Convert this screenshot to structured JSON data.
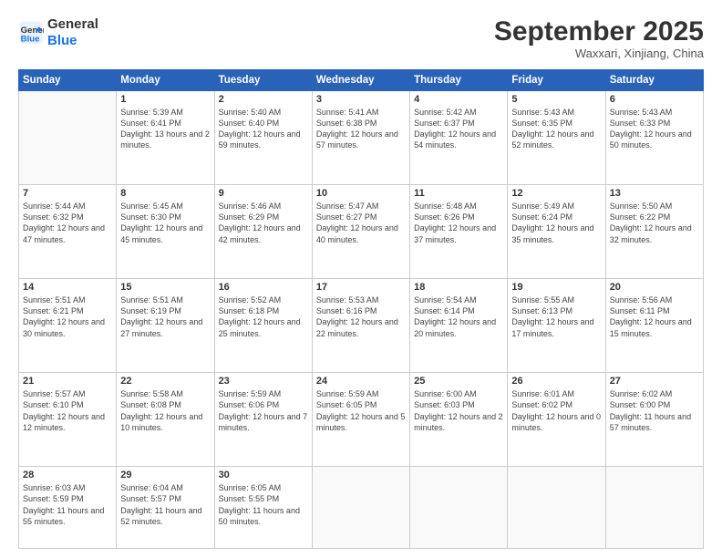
{
  "logo": {
    "line1": "General",
    "line2": "Blue"
  },
  "header": {
    "month": "September 2025",
    "location": "Waxxari, Xinjiang, China"
  },
  "weekdays": [
    "Sunday",
    "Monday",
    "Tuesday",
    "Wednesday",
    "Thursday",
    "Friday",
    "Saturday"
  ],
  "weeks": [
    [
      {
        "day": "",
        "info": ""
      },
      {
        "day": "1",
        "info": "Sunrise: 5:39 AM\nSunset: 6:41 PM\nDaylight: 13 hours\nand 2 minutes."
      },
      {
        "day": "2",
        "info": "Sunrise: 5:40 AM\nSunset: 6:40 PM\nDaylight: 12 hours\nand 59 minutes."
      },
      {
        "day": "3",
        "info": "Sunrise: 5:41 AM\nSunset: 6:38 PM\nDaylight: 12 hours\nand 57 minutes."
      },
      {
        "day": "4",
        "info": "Sunrise: 5:42 AM\nSunset: 6:37 PM\nDaylight: 12 hours\nand 54 minutes."
      },
      {
        "day": "5",
        "info": "Sunrise: 5:43 AM\nSunset: 6:35 PM\nDaylight: 12 hours\nand 52 minutes."
      },
      {
        "day": "6",
        "info": "Sunrise: 5:43 AM\nSunset: 6:33 PM\nDaylight: 12 hours\nand 50 minutes."
      }
    ],
    [
      {
        "day": "7",
        "info": "Sunrise: 5:44 AM\nSunset: 6:32 PM\nDaylight: 12 hours\nand 47 minutes."
      },
      {
        "day": "8",
        "info": "Sunrise: 5:45 AM\nSunset: 6:30 PM\nDaylight: 12 hours\nand 45 minutes."
      },
      {
        "day": "9",
        "info": "Sunrise: 5:46 AM\nSunset: 6:29 PM\nDaylight: 12 hours\nand 42 minutes."
      },
      {
        "day": "10",
        "info": "Sunrise: 5:47 AM\nSunset: 6:27 PM\nDaylight: 12 hours\nand 40 minutes."
      },
      {
        "day": "11",
        "info": "Sunrise: 5:48 AM\nSunset: 6:26 PM\nDaylight: 12 hours\nand 37 minutes."
      },
      {
        "day": "12",
        "info": "Sunrise: 5:49 AM\nSunset: 6:24 PM\nDaylight: 12 hours\nand 35 minutes."
      },
      {
        "day": "13",
        "info": "Sunrise: 5:50 AM\nSunset: 6:22 PM\nDaylight: 12 hours\nand 32 minutes."
      }
    ],
    [
      {
        "day": "14",
        "info": "Sunrise: 5:51 AM\nSunset: 6:21 PM\nDaylight: 12 hours\nand 30 minutes."
      },
      {
        "day": "15",
        "info": "Sunrise: 5:51 AM\nSunset: 6:19 PM\nDaylight: 12 hours\nand 27 minutes."
      },
      {
        "day": "16",
        "info": "Sunrise: 5:52 AM\nSunset: 6:18 PM\nDaylight: 12 hours\nand 25 minutes."
      },
      {
        "day": "17",
        "info": "Sunrise: 5:53 AM\nSunset: 6:16 PM\nDaylight: 12 hours\nand 22 minutes."
      },
      {
        "day": "18",
        "info": "Sunrise: 5:54 AM\nSunset: 6:14 PM\nDaylight: 12 hours\nand 20 minutes."
      },
      {
        "day": "19",
        "info": "Sunrise: 5:55 AM\nSunset: 6:13 PM\nDaylight: 12 hours\nand 17 minutes."
      },
      {
        "day": "20",
        "info": "Sunrise: 5:56 AM\nSunset: 6:11 PM\nDaylight: 12 hours\nand 15 minutes."
      }
    ],
    [
      {
        "day": "21",
        "info": "Sunrise: 5:57 AM\nSunset: 6:10 PM\nDaylight: 12 hours\nand 12 minutes."
      },
      {
        "day": "22",
        "info": "Sunrise: 5:58 AM\nSunset: 6:08 PM\nDaylight: 12 hours\nand 10 minutes."
      },
      {
        "day": "23",
        "info": "Sunrise: 5:59 AM\nSunset: 6:06 PM\nDaylight: 12 hours\nand 7 minutes."
      },
      {
        "day": "24",
        "info": "Sunrise: 5:59 AM\nSunset: 6:05 PM\nDaylight: 12 hours\nand 5 minutes."
      },
      {
        "day": "25",
        "info": "Sunrise: 6:00 AM\nSunset: 6:03 PM\nDaylight: 12 hours\nand 2 minutes."
      },
      {
        "day": "26",
        "info": "Sunrise: 6:01 AM\nSunset: 6:02 PM\nDaylight: 12 hours\nand 0 minutes."
      },
      {
        "day": "27",
        "info": "Sunrise: 6:02 AM\nSunset: 6:00 PM\nDaylight: 11 hours\nand 57 minutes."
      }
    ],
    [
      {
        "day": "28",
        "info": "Sunrise: 6:03 AM\nSunset: 5:59 PM\nDaylight: 11 hours\nand 55 minutes."
      },
      {
        "day": "29",
        "info": "Sunrise: 6:04 AM\nSunset: 5:57 PM\nDaylight: 11 hours\nand 52 minutes."
      },
      {
        "day": "30",
        "info": "Sunrise: 6:05 AM\nSunset: 5:55 PM\nDaylight: 11 hours\nand 50 minutes."
      },
      {
        "day": "",
        "info": ""
      },
      {
        "day": "",
        "info": ""
      },
      {
        "day": "",
        "info": ""
      },
      {
        "day": "",
        "info": ""
      }
    ]
  ]
}
